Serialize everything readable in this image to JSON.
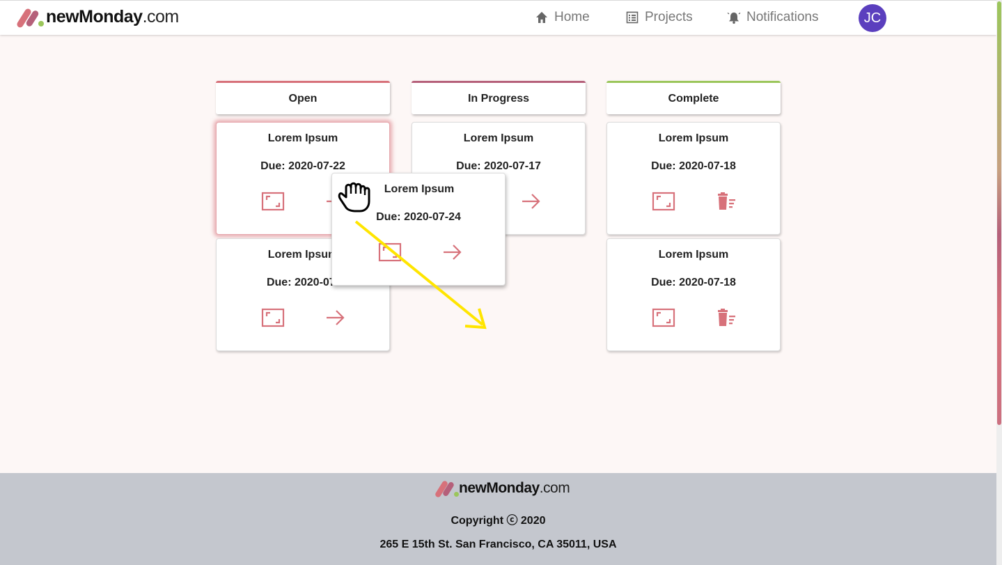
{
  "header": {
    "brand": "newMonday",
    "tld": ".com",
    "nav": {
      "home": "Home",
      "projects": "Projects",
      "notifications": "Notifications"
    },
    "avatar_initials": "JC"
  },
  "colors": {
    "accent": "#d7717a",
    "open": "#d7717a",
    "in_progress": "#b5607a",
    "complete": "#9bc65b",
    "avatar": "#5b3fbe",
    "footer_bg": "#c4c7ce",
    "drag_arrow": "#ffe500"
  },
  "board": {
    "columns": [
      {
        "title": "Open",
        "cards": [
          {
            "title": "Lorem Ipsum",
            "due": "Due: 2020-07-22",
            "selected": true,
            "icons": [
              "expand-icon",
              "arrow-right-icon"
            ]
          },
          {
            "title": "Lorem Ipsum",
            "due": "Due: 2020-07-",
            "icons": [
              "expand-icon",
              "arrow-right-icon"
            ]
          }
        ]
      },
      {
        "title": "In Progress",
        "cards": [
          {
            "title": "Lorem Ipsum",
            "due": "Due: 2020-07-17",
            "icons": [
              "expand-icon",
              "arrow-right-icon"
            ]
          }
        ]
      },
      {
        "title": "Complete",
        "cards": [
          {
            "title": "Lorem Ipsum",
            "due": "Due: 2020-07-18",
            "icons": [
              "expand-icon",
              "trash-icon"
            ]
          },
          {
            "title": "Lorem Ipsum",
            "due": "Due: 2020-07-18",
            "icons": [
              "expand-icon",
              "trash-icon"
            ]
          }
        ]
      }
    ],
    "dragging_card": {
      "title": "Lorem Ipsum",
      "due": "Due: 2020-07-24",
      "icons": [
        "expand-icon",
        "arrow-right-icon",
        "grab-hand-icon"
      ]
    }
  },
  "footer": {
    "brand": "newMonday",
    "tld": ".com",
    "copyright": "Copyright ⓒ 2020",
    "address": "265 E 15th St. San Francisco, CA 35011, USA"
  }
}
